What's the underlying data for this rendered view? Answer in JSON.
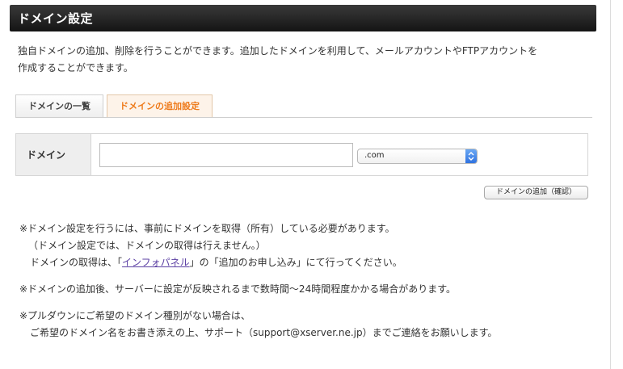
{
  "header": {
    "title": "ドメイン設定"
  },
  "intro": {
    "line1": "独自ドメインの追加、削除を行うことができます。追加したドメインを利用して、メールアカウントやFTPアカウントを",
    "line2": "作成することができます。"
  },
  "tabs": [
    {
      "label": "ドメインの一覧",
      "active": false
    },
    {
      "label": "ドメインの追加設定",
      "active": true
    }
  ],
  "form": {
    "label": "ドメイン",
    "input_value": "",
    "tld_selected": ".com",
    "submit_label": "ドメインの追加（確認）"
  },
  "notes": {
    "n1_line1": "※ドメイン設定を行うには、事前にドメインを取得（所有）している必要があります。",
    "n1_line2": "（ドメイン設定では、ドメインの取得は行えません。）",
    "n1_line3_pre": "ドメインの取得は、「",
    "n1_link": "インフォパネル",
    "n1_line3_post": "」の「追加のお申し込み」にて行ってください。",
    "n2": "※ドメインの追加後、サーバーに設定が反映されるまで数時間〜24時間程度かかる場合があります。",
    "n3_line1": "※プルダウンにご希望のドメイン種別がない場合は、",
    "n3_line2": "ご希望のドメイン名をお書き添えの上、サポート（support@xserver.ne.jp）までご連絡をお願いします。"
  },
  "colors": {
    "active_tab_text": "#ee7a1a",
    "link": "#5b3fa3",
    "header_bg": "#1e1e1e"
  }
}
